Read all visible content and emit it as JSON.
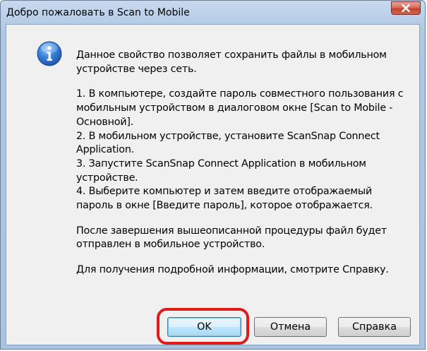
{
  "window": {
    "title": "Добро пожаловать в Scan to Mobile"
  },
  "message": {
    "intro": "Данное свойство позволяет сохранить файлы в мобильном устройстве через сеть.",
    "steps": [
      "1. В компьютере, создайте пароль совместного пользования с мобильным устройством в диалоговом окне [Scan to Mobile - Основной].",
      "2. В мобильном устройстве, установите ScanSnap Connect Application.",
      "3. Запустите ScanSnap Connect Application в мобильном устройстве.",
      "4. Выберите компьютер и затем введите отображаемый пароль в окне [Введите пароль], которое отображается."
    ],
    "after": "После завершения вышеописанной процедуры файл будет отправлен в мобильное устройство.",
    "help_note": "Для получения подробной информации, смотрите Справку."
  },
  "buttons": {
    "ok_label": "OK",
    "cancel_label": "Отмена",
    "help_label": "Справка"
  },
  "icons": {
    "info": "info-icon",
    "close": "close-icon"
  },
  "colors": {
    "highlight": "#e01b1b",
    "close_button": "#c24330",
    "info_icon": "#2a6fd0"
  }
}
